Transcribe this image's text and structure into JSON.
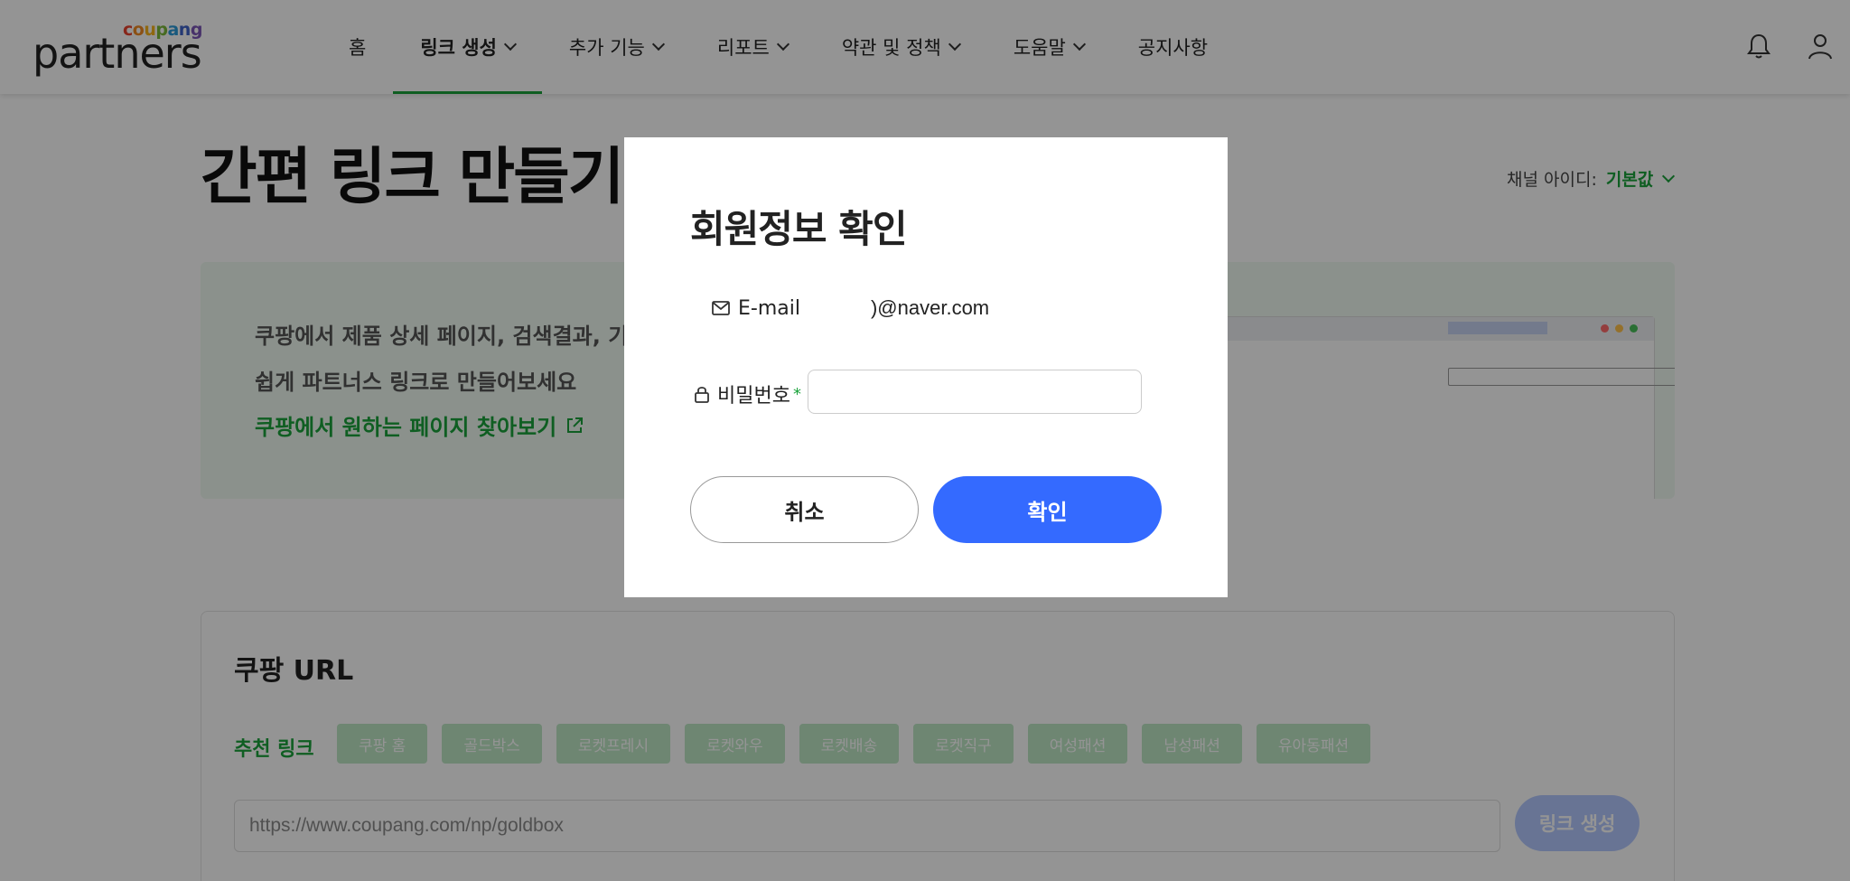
{
  "header": {
    "logo_top": "coupang",
    "logo_main": "partners",
    "nav": [
      {
        "label": "홈",
        "dropdown": false,
        "active": false
      },
      {
        "label": "링크 생성",
        "dropdown": true,
        "active": true
      },
      {
        "label": "추가 기능",
        "dropdown": true,
        "active": false
      },
      {
        "label": "리포트",
        "dropdown": true,
        "active": false
      },
      {
        "label": "약관 및 정책",
        "dropdown": true,
        "active": false
      },
      {
        "label": "도움말",
        "dropdown": true,
        "active": false
      },
      {
        "label": "공지사항",
        "dropdown": false,
        "active": false
      }
    ],
    "icons": [
      "bell-icon",
      "user-icon"
    ]
  },
  "page": {
    "title": "간편 링크 만들기",
    "channel_label": "채널 아이디:",
    "channel_value": "기본값",
    "banner": {
      "line1": "쿠팡에서 제품 상세 페이지, 검색결과, 기획",
      "line2": "쉽게 파트너스 링크로 만들어보세요",
      "link": "쿠팡에서 원하는 페이지 찾아보기"
    },
    "card": {
      "title": "쿠팡 URL",
      "recommend_label": "추천 링크",
      "chips": [
        "쿠팡 홈",
        "골드박스",
        "로켓프레시",
        "로켓와우",
        "로켓배송",
        "로켓직구",
        "여성패션",
        "남성패션",
        "유아동패션"
      ],
      "url_placeholder": "https://www.coupang.com/np/goldbox",
      "generate_button": "링크 생성"
    }
  },
  "modal": {
    "title": "회원정보 확인",
    "email_label": "E-mail",
    "email_value": ")@naver.com",
    "password_label": "비밀번호",
    "required_mark": "*",
    "password_value": "",
    "cancel_label": "취소",
    "confirm_label": "확인"
  },
  "colors": {
    "accent_green": "#1aa33b",
    "primary_blue": "#346aff",
    "overlay": "rgba(0,0,0,0.42)"
  }
}
